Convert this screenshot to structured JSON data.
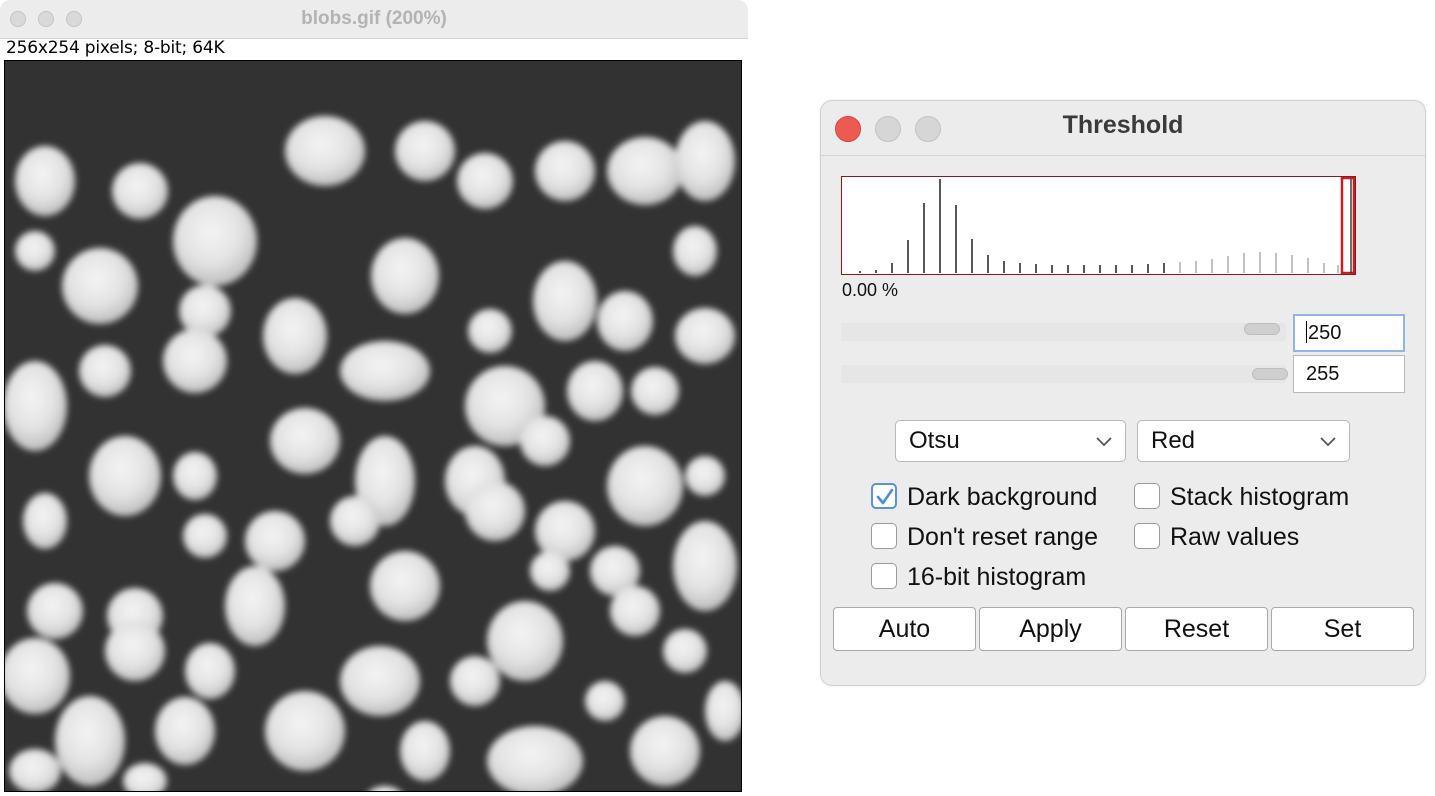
{
  "image_window": {
    "title": "blobs.gif (200%)",
    "info": "256x254 pixels; 8-bit; 64K"
  },
  "threshold_dialog": {
    "title": "Threshold",
    "histogram_percent": "0.00 %",
    "min_value": "250",
    "max_value": "255",
    "method_select": "Otsu",
    "display_select": "Red",
    "checkboxes": {
      "dark_background": {
        "label": "Dark background",
        "checked": true
      },
      "stack_histogram": {
        "label": "Stack histogram",
        "checked": false
      },
      "dont_reset_range": {
        "label": "Don't reset range",
        "checked": false
      },
      "raw_values": {
        "label": "Raw values",
        "checked": false
      },
      "hist16": {
        "label": "16-bit histogram",
        "checked": false
      }
    },
    "buttons": {
      "auto": "Auto",
      "apply": "Apply",
      "reset": "Reset",
      "set": "Set"
    },
    "colors": {
      "close_red": "#ee5a52",
      "threshold_red": "#c81e1e",
      "checkbox_blue": "#4a8be0"
    }
  }
}
